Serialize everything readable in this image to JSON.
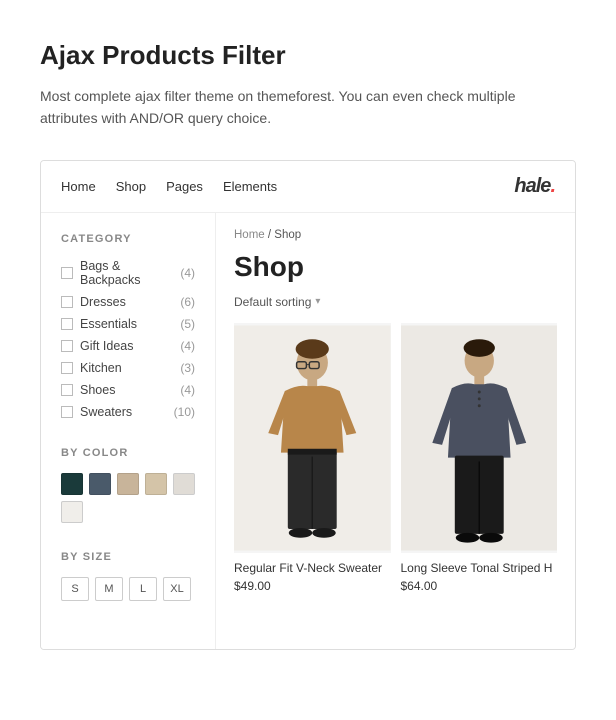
{
  "page": {
    "title": "Ajax Products Filter",
    "description": "Most complete ajax filter theme on themeforest. You can even check multiple attributes with AND/OR query choice."
  },
  "nav": {
    "links": [
      "Home",
      "Shop",
      "Pages",
      "Elements"
    ],
    "logo": "hale"
  },
  "sidebar": {
    "category_section": {
      "title": "CATEGORY",
      "items": [
        {
          "name": "Bags & Backpacks",
          "count": "(4)"
        },
        {
          "name": "Dresses",
          "count": "(6)"
        },
        {
          "name": "Essentials",
          "count": "(5)"
        },
        {
          "name": "Gift Ideas",
          "count": "(4)"
        },
        {
          "name": "Kitchen",
          "count": "(3)"
        },
        {
          "name": "Shoes",
          "count": "(4)"
        },
        {
          "name": "Sweaters",
          "count": "(10)"
        }
      ]
    },
    "color_section": {
      "title": "BY COLOR",
      "colors": [
        {
          "name": "dark-teal",
          "hex": "#1a3a3a"
        },
        {
          "name": "slate-blue",
          "hex": "#4a5a6a"
        },
        {
          "name": "tan",
          "hex": "#c8b49a"
        },
        {
          "name": "beige",
          "hex": "#d4c4a8"
        },
        {
          "name": "light-gray",
          "hex": "#e8e4de"
        },
        {
          "name": "gray",
          "hex": "#c8c4be"
        },
        {
          "name": "white-gray",
          "hex": "#f0eeea"
        }
      ]
    },
    "size_section": {
      "title": "BY SIZE",
      "sizes": [
        "S",
        "M",
        "L",
        "XL"
      ]
    }
  },
  "shop": {
    "breadcrumb_home": "Home",
    "breadcrumb_sep": "/",
    "breadcrumb_current": "Shop",
    "title": "Shop",
    "sorting_label": "Default sorting",
    "products": [
      {
        "name": "Regular Fit V-Neck Sweater",
        "price": "$49.00"
      },
      {
        "name": "Long Sleeve Tonal Striped H",
        "price": "$64.00"
      }
    ]
  }
}
